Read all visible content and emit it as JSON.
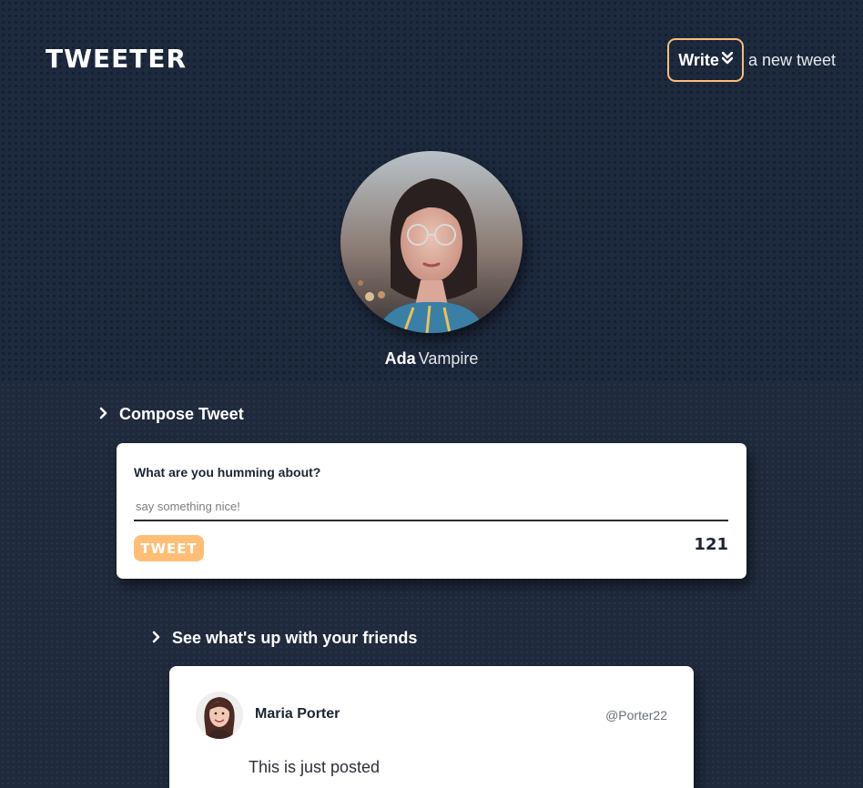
{
  "header": {
    "brand": "TWEETER",
    "write_label": "Write",
    "write_icon": "chevrons-down-icon",
    "nav_text": "a new tweet",
    "accent_color": "#ffbe76"
  },
  "profile": {
    "first_name": "Ada",
    "last_name": "Vampire"
  },
  "compose": {
    "section_title": "Compose Tweet",
    "prompt_label": "What are you humming about?",
    "input_value": "",
    "input_placeholder": "say something nice!",
    "submit_label": "TWEET",
    "char_counter": "121"
  },
  "feed": {
    "section_title": "See what's up with your friends",
    "tweets": [
      {
        "name": "Maria Porter",
        "handle": "@Porter22",
        "text": "This is just posted"
      }
    ]
  }
}
